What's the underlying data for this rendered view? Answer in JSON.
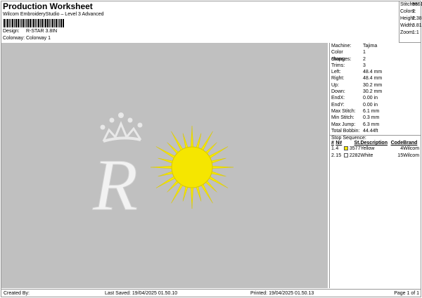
{
  "header": {
    "title": "Production Worksheet",
    "subtitle": "Wilcom EmbroideryStudio – Level 3 Advanced",
    "design_label": "Design:",
    "design": "R-STAR 3.8IN",
    "colorway_label": "Colorway:",
    "colorway": "Colorway 1"
  },
  "summary": [
    {
      "label": "Stitches:",
      "value": "5861"
    },
    {
      "label": "Colors:",
      "value": "2"
    },
    {
      "label": "Height:",
      "value": "2.38 in"
    },
    {
      "label": "Width:",
      "value": "3.81 in"
    },
    {
      "label": "Zoom:",
      "value": "1:1"
    }
  ],
  "details": [
    {
      "label": "Machine:",
      "value": "Tajima"
    },
    {
      "label": "Color changes:",
      "value": "1"
    },
    {
      "label": "Stops:",
      "value": "2"
    },
    {
      "label": "Trims:",
      "value": "3"
    },
    {
      "label": "Left:",
      "value": "48.4 mm"
    },
    {
      "label": "Right:",
      "value": "48.4 mm"
    },
    {
      "label": "Up:",
      "value": "30.2 mm"
    },
    {
      "label": "Down:",
      "value": "30.2 mm"
    },
    {
      "label": "EndX:",
      "value": "0.00 in"
    },
    {
      "label": "EndY:",
      "value": "0.00 in"
    },
    {
      "label": "Max Stitch:",
      "value": "6.1 mm"
    },
    {
      "label": "Min Stitch:",
      "value": "0.3 mm"
    },
    {
      "label": "Max Jump:",
      "value": "6.3 mm"
    },
    {
      "label": "Total Bobbin:",
      "value": "44.44ft"
    }
  ],
  "stop_sequence": {
    "title": "Stop Sequence:",
    "headers": [
      "#",
      "N#",
      "St.",
      "Description",
      "Code",
      "Brand"
    ],
    "rows": [
      {
        "idx": "1.",
        "n": "4",
        "color": "#f5e600",
        "st": "3577",
        "desc": "Yellow",
        "code": "4",
        "brand": "Wilcom"
      },
      {
        "idx": "2.",
        "n": "15",
        "color": "#ffffff",
        "st": "2282",
        "desc": "White",
        "code": "15",
        "brand": "Wilcom"
      }
    ]
  },
  "footer": {
    "created": "Created By:",
    "saved": "Last Saved: 19/04/2025 01.50.10",
    "printed": "Printed: 19/04/2025 01.50.13",
    "page": "Page 1 of 1"
  },
  "colors": {
    "canvas": "#c0c0c0",
    "yellow": "#f5e600",
    "white": "#f4f4f4"
  }
}
